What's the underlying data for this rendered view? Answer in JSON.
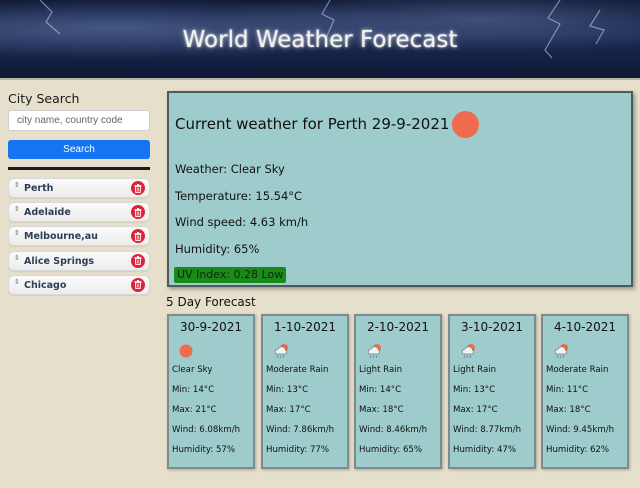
{
  "header": {
    "title": "World Weather Forecast"
  },
  "sidebar": {
    "heading": "City Search",
    "search_placeholder": "city name, country code",
    "search_button": "Search",
    "cities": [
      {
        "name": "Perth"
      },
      {
        "name": "Adelaide"
      },
      {
        "name": "Melbourne,au"
      },
      {
        "name": "Alice Springs"
      },
      {
        "name": "Chicago"
      }
    ]
  },
  "current": {
    "title": "Current weather for Perth 29-9-2021",
    "icon": "sun-icon",
    "weather": "Weather: Clear Sky",
    "temperature": "Temperature: 15.54°C",
    "wind": "Wind speed: 4.63 km/h",
    "humidity": "Humidity: 65%",
    "uv": "UV Index: 0.28 Low"
  },
  "forecast": {
    "heading": "5 Day Forecast",
    "days": [
      {
        "date": "30-9-2021",
        "icon": "sun-icon",
        "desc": "Clear Sky",
        "min": "Min: 14°C",
        "max": "Max: 21°C",
        "wind": "Wind: 6.08km/h",
        "humidity": "Humidity: 57%"
      },
      {
        "date": "1-10-2021",
        "icon": "rain-cloud-icon",
        "desc": "Moderate Rain",
        "min": "Min: 13°C",
        "max": "Max: 17°C",
        "wind": "Wind: 7.86km/h",
        "humidity": "Humidity: 77%"
      },
      {
        "date": "2-10-2021",
        "icon": "rain-cloud-icon",
        "desc": "Light Rain",
        "min": "Min: 14°C",
        "max": "Max: 18°C",
        "wind": "Wind: 8.46km/h",
        "humidity": "Humidity: 65%"
      },
      {
        "date": "3-10-2021",
        "icon": "rain-cloud-icon",
        "desc": "Light Rain",
        "min": "Min: 13°C",
        "max": "Max: 17°C",
        "wind": "Wind: 8.77km/h",
        "humidity": "Humidity: 47%"
      },
      {
        "date": "4-10-2021",
        "icon": "rain-cloud-icon",
        "desc": "Moderate Rain",
        "min": "Min: 11°C",
        "max": "Max: 18°C",
        "wind": "Wind: 9.45km/h",
        "humidity": "Humidity: 62%"
      }
    ]
  },
  "colors": {
    "sun": "#ee6c4d",
    "card_bg": "#9ecccc",
    "search_button": "#1474f2",
    "delete_button": "#e3203a",
    "uv_low": "#1b8a1b",
    "page_bg": "#e5dfcb"
  }
}
